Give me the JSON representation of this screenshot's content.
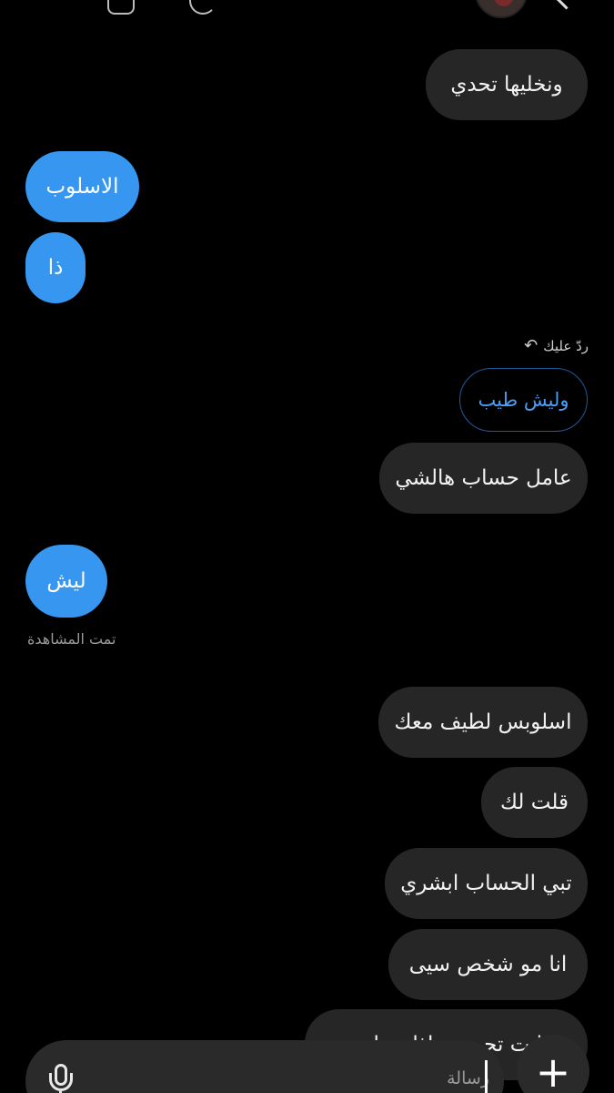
{
  "messages": {
    "m1": "ونخليها تحدي",
    "m2": "الاسلوب",
    "m3": "ذا",
    "m4": "عامل حساب هالشي",
    "m5": "ليش",
    "m6": "اسلوبس لطيف معك",
    "m7": "قلت لك",
    "m8": "تبي الحساب ابشري",
    "m9": "انا مو شخص سيى",
    "m10": "انت تجي ... اذا ... ابي"
  },
  "reply": {
    "label": "ردّ عليك",
    "quoted": "وليش طيب"
  },
  "status": {
    "seen": "تمت المشاهدة"
  },
  "composer": {
    "placeholder": "رسالة",
    "plus": "+"
  },
  "icons": {
    "mic": "microphone-icon",
    "reply": "reply-arrow-icon",
    "plus": "plus-icon"
  },
  "colors": {
    "background": "#000000",
    "incoming_bubble": "#262626",
    "outgoing_bubble": "#3797f0",
    "quote_border": "#1f5a99"
  }
}
